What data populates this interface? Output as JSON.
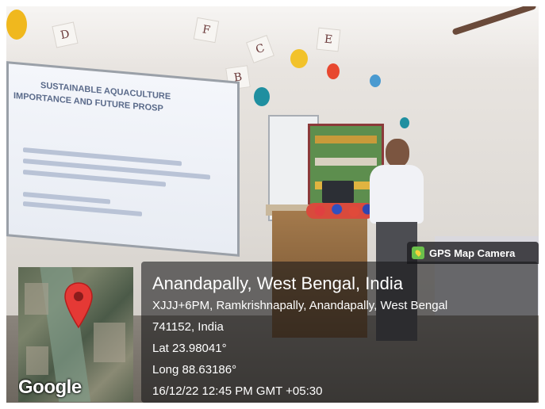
{
  "screen": {
    "slide_title_1": "SUSTAINABLE AQUACULTURE",
    "slide_title_2": "IMPORTANCE AND FUTURE PROSP"
  },
  "classroom": {
    "wall_letters": [
      "D",
      "F",
      "C",
      "E",
      "B"
    ]
  },
  "map": {
    "attribution": "Google",
    "pin_color": "#e53935"
  },
  "camera_badge": {
    "label": "GPS Map Camera",
    "icon": "map-camera-icon"
  },
  "geotag": {
    "place": "Anandapally, West Bengal, India",
    "address_line_1": "XJJJ+6PM, Ramkrishnapally, Anandapally, West Bengal",
    "address_line_2": "741152, India",
    "latitude": "Lat 23.98041°",
    "longitude": "Long 88.63186°",
    "timestamp": "16/12/22 12:45 PM GMT +05:30"
  }
}
